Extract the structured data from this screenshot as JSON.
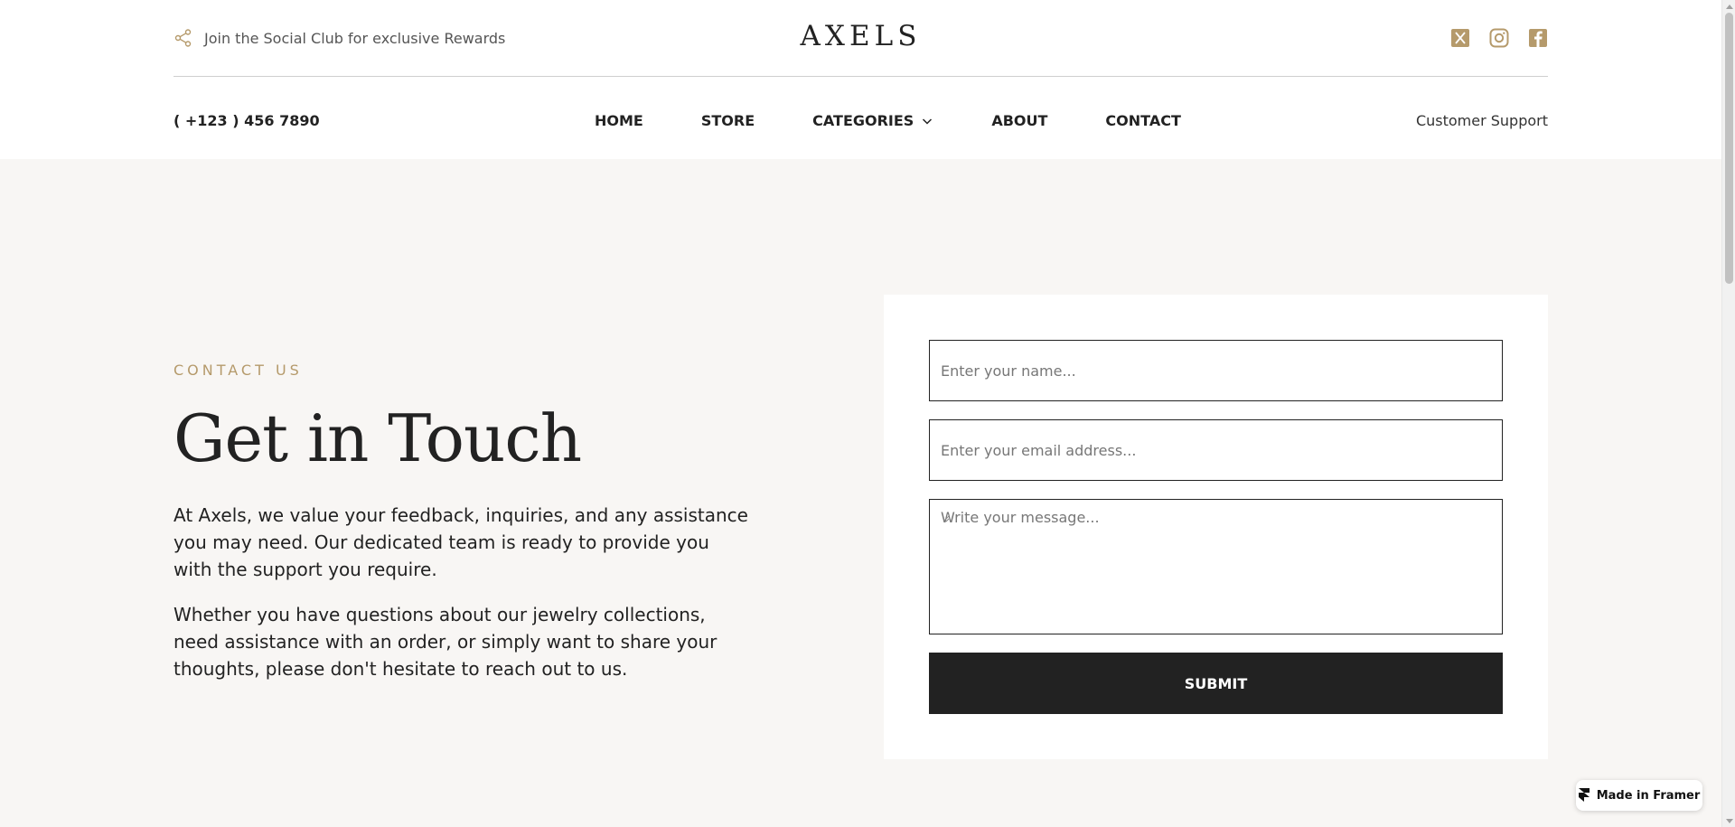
{
  "header": {
    "social_club_text": "Join the Social Club for exclusive Rewards",
    "logo": "AXELS",
    "phone": "( +123 ) 456 7890",
    "support": "Customer Support",
    "socials": [
      {
        "icon": "x-twitter-icon"
      },
      {
        "icon": "instagram-icon"
      },
      {
        "icon": "facebook-icon"
      }
    ],
    "nav": [
      "HOME",
      "STORE",
      "CATEGORIES",
      "ABOUT",
      "CONTACT"
    ]
  },
  "contact": {
    "eyebrow": "CONTACT US",
    "title": "Get in Touch",
    "para1": "At Axels, we value your feedback, inquiries, and any assistance you may need. Our dedicated team is ready to provide you with the support you require.",
    "para2": "Whether you have questions about our jewelry collections, need assistance with an order, or simply want to share your thoughts, please don't hesitate to reach out to us."
  },
  "form": {
    "name_placeholder": "Enter your name...",
    "email_placeholder": "Enter your email address...",
    "message_placeholder": "Write your message...",
    "submit_label": "SUBMIT"
  },
  "badge": {
    "label": "Made in Framer"
  },
  "colors": {
    "accent": "#b59a6b",
    "dark": "#222222",
    "background": "#f8f6f4"
  }
}
